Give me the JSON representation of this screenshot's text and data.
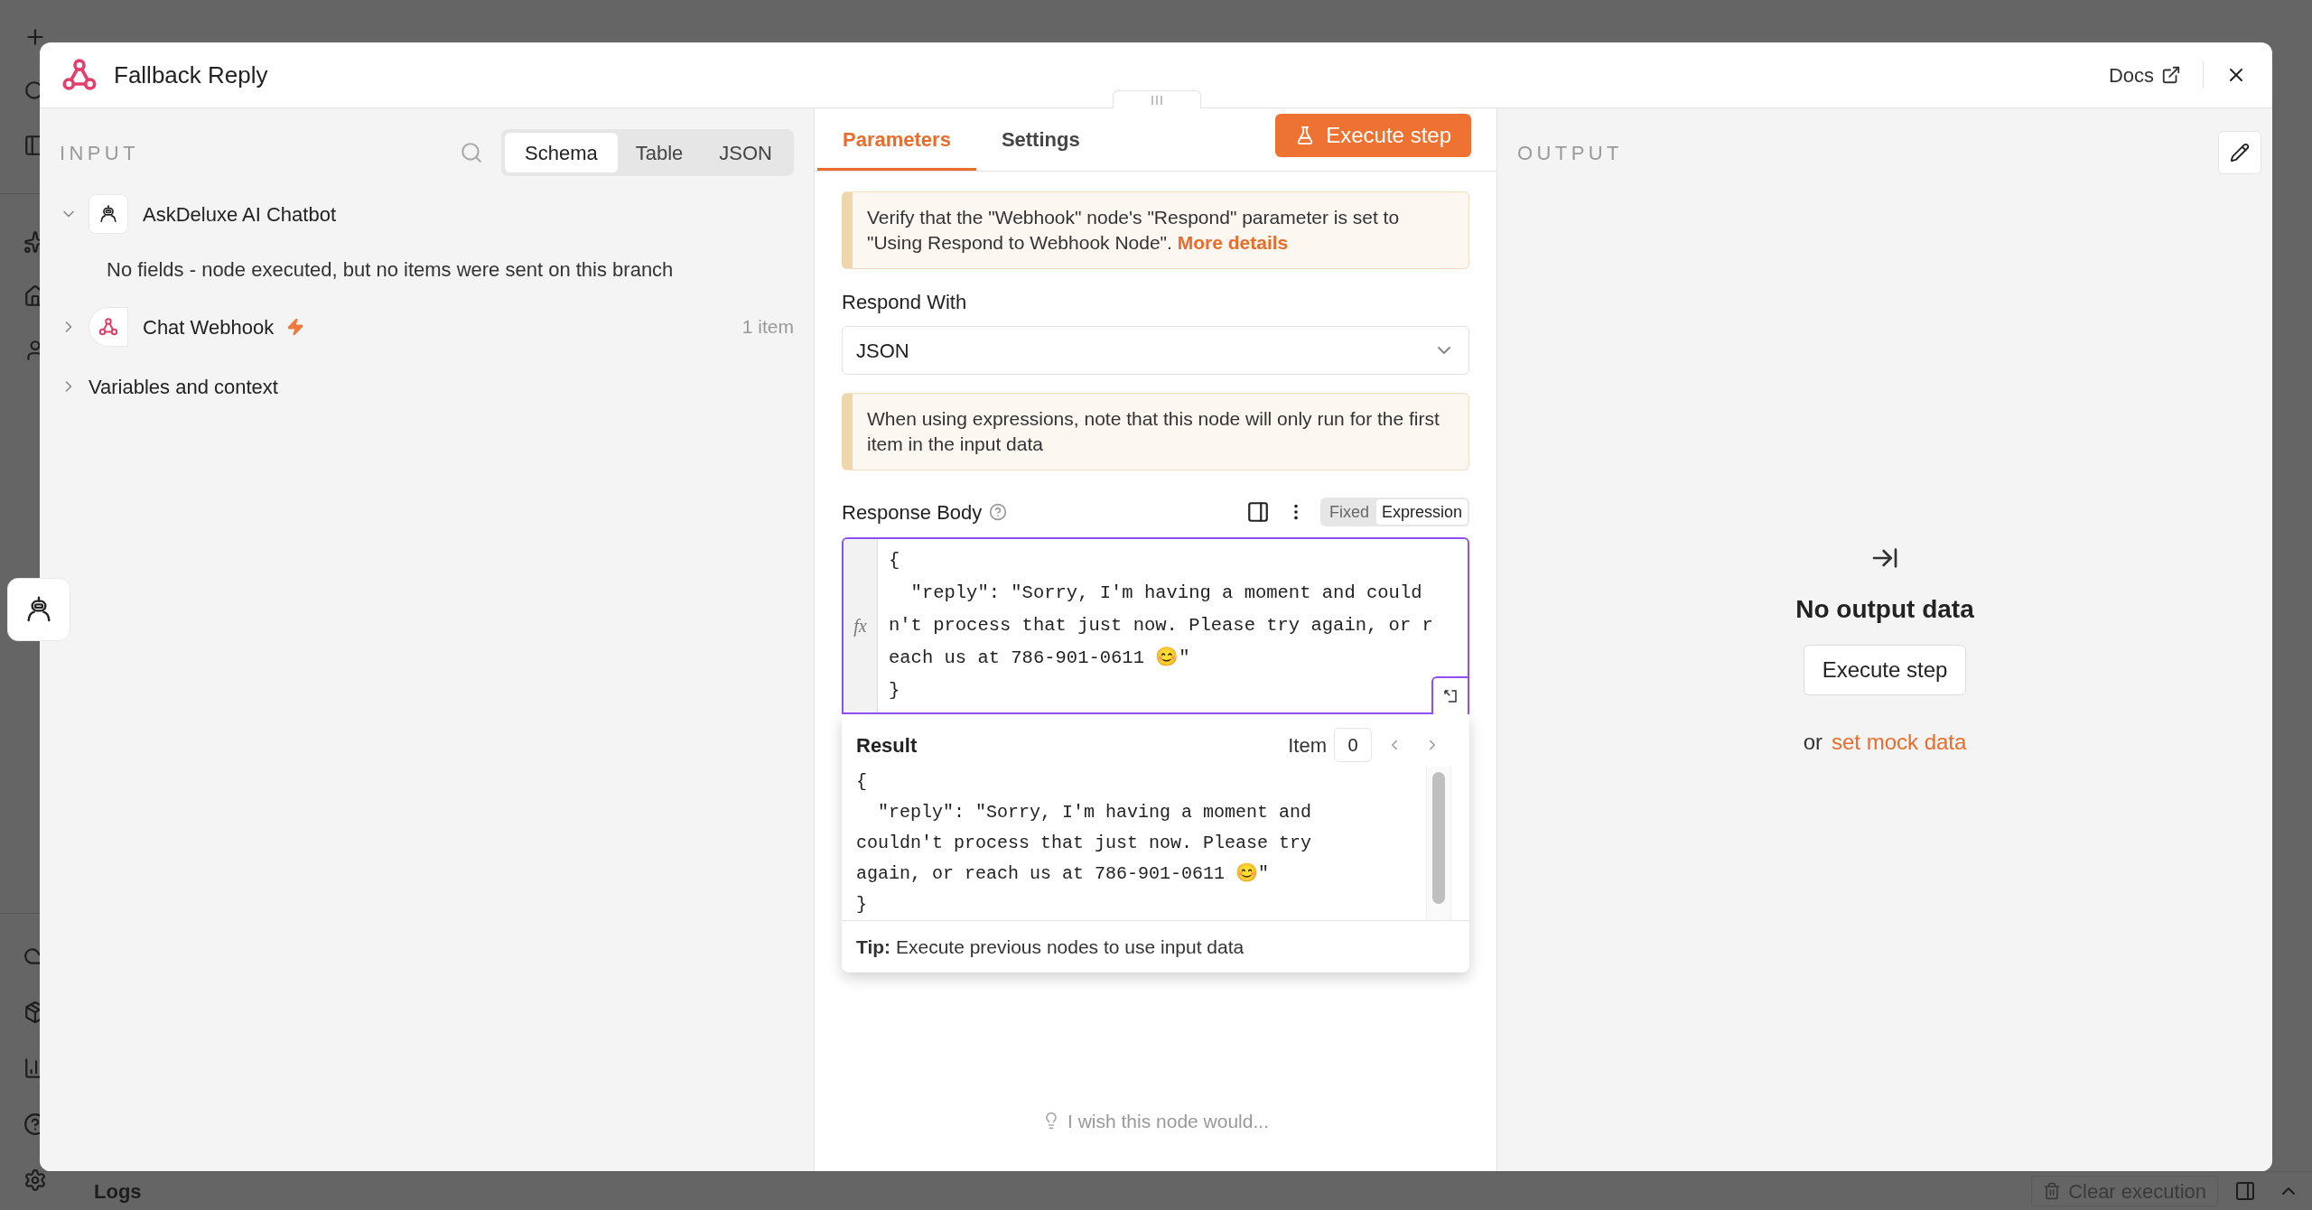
{
  "modal": {
    "title": "Fallback Reply",
    "docs_link": "Docs"
  },
  "input_panel": {
    "label": "INPUT",
    "view_tabs": [
      {
        "label": "Schema",
        "selected": true
      },
      {
        "label": "Table",
        "selected": false
      },
      {
        "label": "JSON",
        "selected": false
      }
    ],
    "nodes": [
      {
        "kind": "chatbot",
        "name": "AskDeluxe AI Chatbot",
        "expanded": true,
        "trigger": false,
        "message": "No fields - node executed, but no items were sent on this branch"
      },
      {
        "kind": "webhook",
        "name": "Chat Webhook",
        "expanded": false,
        "trigger": true,
        "count": "1 item"
      }
    ],
    "variables": {
      "label": "Variables and context",
      "expanded": false
    }
  },
  "parameters_panel": {
    "tabs": [
      {
        "label": "Parameters",
        "selected": true
      },
      {
        "label": "Settings",
        "selected": false
      }
    ],
    "execute_button": "Execute step",
    "notices": [
      {
        "text": "Verify that the \"Webhook\" node's \"Respond\" parameter is set to \"Using Respond to Webhook Node\".",
        "link": "More details"
      },
      {
        "text": "When using expressions, note that this node will only run for the first item in the input data"
      }
    ],
    "respond_with": {
      "label": "Respond With",
      "value": "JSON"
    },
    "response_body": {
      "label": "Response Body",
      "modes": [
        {
          "label": "Fixed",
          "selected": false
        },
        {
          "label": "Expression",
          "selected": true
        }
      ],
      "gutter": "fx",
      "code_lines": [
        "{",
        "  \"reply\": \"Sorry, I'm having a moment and could",
        "n't process that just now. Please try again, or r",
        "each us at 786-901-0611 😊\"",
        "}"
      ]
    },
    "result": {
      "title": "Result",
      "item_label": "Item",
      "item_value": "0",
      "lines": [
        "{",
        "  \"reply\": \"Sorry, I'm having a moment and",
        "couldn't process that just now. Please try",
        "again, or reach us at 786-901-0611 😊\"",
        "}"
      ],
      "tip_label": "Tip:",
      "tip": "Execute previous nodes to use input data"
    },
    "feedback": "I wish this node would..."
  },
  "output_panel": {
    "label": "OUTPUT",
    "empty_title": "No output data",
    "execute_button": "Execute step",
    "mock_prefix": "or",
    "mock_link": "set mock data"
  },
  "bottom_bar": {
    "logs": "Logs",
    "clear_button": "Clear execution"
  }
}
